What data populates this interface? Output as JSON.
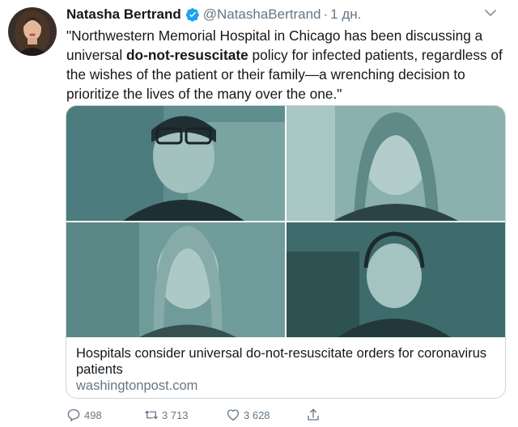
{
  "tweet": {
    "author_name": "Natasha Bertrand",
    "author_handle": "@NatashaBertrand",
    "separator": "·",
    "time": "1 дн.",
    "text_before": "\"Northwestern Memorial Hospital in Chicago has been discussing a universal ",
    "text_bold": "do-not-resuscitate",
    "text_after": " policy for infected patients, regardless of the wishes of the patient or their family—a wrenching decision to prioritize the lives of the many over the one.\""
  },
  "card": {
    "title": "Hospitals consider universal do-not-resuscitate orders for coronavirus patients",
    "domain": "washingtonpost.com"
  },
  "actions": {
    "reply_count": "498",
    "retweet_count": "3 713",
    "like_count": "3 628"
  },
  "icons": {
    "verified": "verified-badge-icon",
    "caret": "chevron-down-icon",
    "reply": "reply-icon",
    "retweet": "retweet-icon",
    "like": "heart-icon",
    "share": "share-icon"
  },
  "colors": {
    "verified_blue": "#1da1f2",
    "secondary_text": "#657786",
    "border": "#ccd6dd",
    "image_tint": "#3b6e6e"
  }
}
